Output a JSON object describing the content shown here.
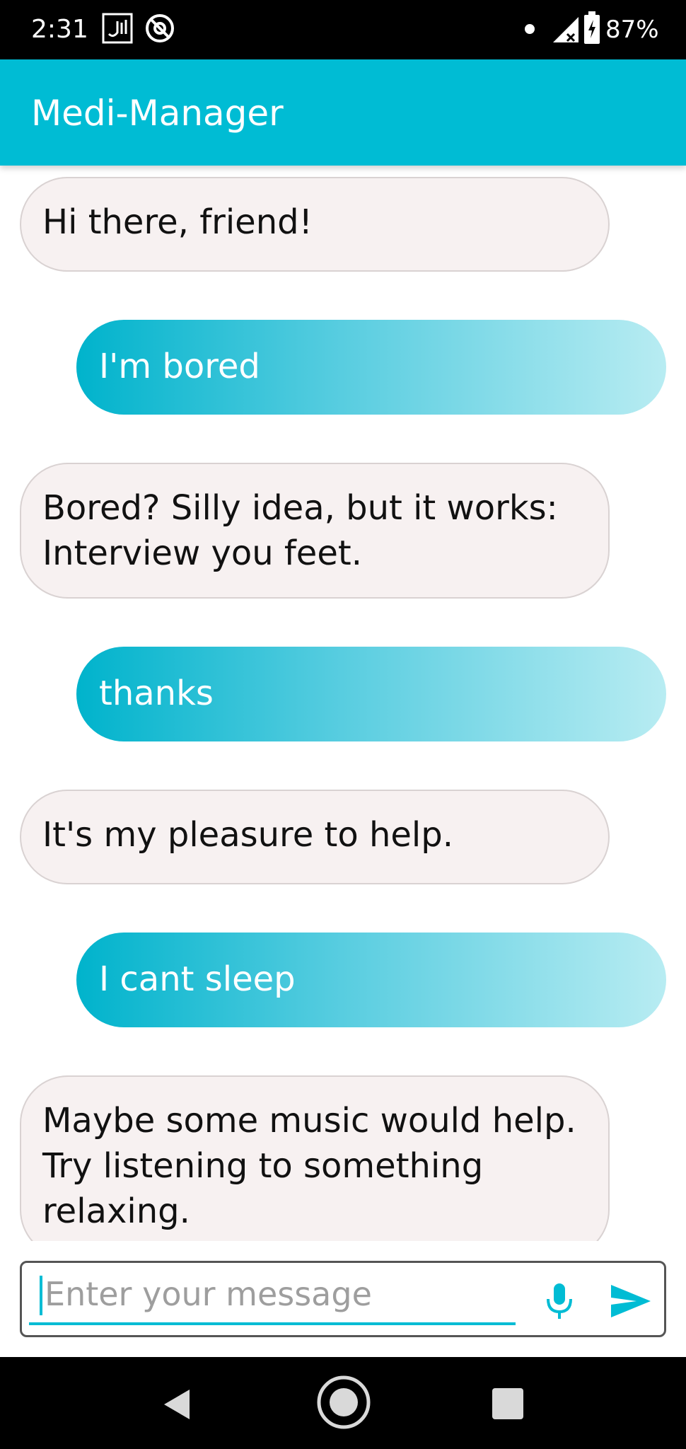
{
  "status_bar": {
    "time": "2:31",
    "battery": "87%"
  },
  "app_bar": {
    "title": "Medi-Manager"
  },
  "messages": [
    {
      "sender": "bot",
      "text": "Hi there, friend!"
    },
    {
      "sender": "user",
      "text": "I'm bored"
    },
    {
      "sender": "bot",
      "text": "Bored? Silly idea, but it works: Interview you feet."
    },
    {
      "sender": "user",
      "text": "thanks"
    },
    {
      "sender": "bot",
      "text": "It's my pleasure to help."
    },
    {
      "sender": "user",
      "text": "I cant sleep"
    },
    {
      "sender": "bot",
      "text": "Maybe some music would help. Try listening to something relaxing."
    }
  ],
  "input": {
    "value": "",
    "placeholder": "Enter your message"
  },
  "icons": {
    "mic": "mic-icon",
    "send": "send-icon",
    "nav_back": "back-triangle-icon",
    "nav_home": "home-circle-icon",
    "nav_recents": "recents-square-icon"
  },
  "colors": {
    "accent": "#00bcd4",
    "bot_bubble": "#f7f1f1",
    "user_bubble_start": "#00b3cc",
    "user_bubble_end": "#b8ecf2"
  }
}
